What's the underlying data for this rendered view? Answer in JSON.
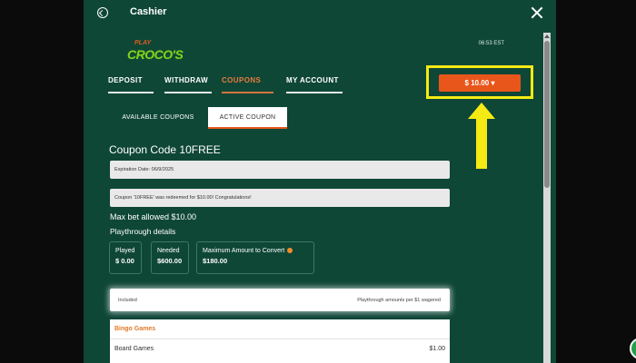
{
  "window": {
    "title": "Cashier",
    "back_icon": "back-icon",
    "close_icon": "close-icon"
  },
  "brand": {
    "logo_top": "PLAY",
    "logo_main": "CROCO'S"
  },
  "time": "06:53 EST",
  "tabs": [
    {
      "label": "DEPOSIT",
      "active": false
    },
    {
      "label": "WITHDRAW",
      "active": false
    },
    {
      "label": "COUPONS",
      "active": true
    },
    {
      "label": "MY ACCOUNT",
      "active": false
    }
  ],
  "balance": {
    "label": "$ 10.00 ▾"
  },
  "subtabs": {
    "available": "AVAILABLE COUPONS",
    "active": "ACTIVE COUPON"
  },
  "coupon": {
    "code_label": "Coupon Code  10FREE",
    "expiration": "Expiration Date: 06/9/2025",
    "message": "Coupon '10FREE' was redeemed for $10.00! Congratulations!",
    "max_bet": "Max bet allowed  $10.00",
    "playthrough_label": "Playthrough details"
  },
  "stats": {
    "played": {
      "label": "Played",
      "value": "$ 0.00"
    },
    "needed": {
      "label": "Needed",
      "value": "$600.00"
    },
    "max_convert": {
      "label": "Maximum Amount to Convert",
      "value": "$180.00"
    }
  },
  "included": {
    "left": "Included",
    "right": "Playthrough amounts per $1 wagered"
  },
  "games": {
    "category": "Bingo Games",
    "rows": [
      {
        "name": "Board Games",
        "amount": "$1.00"
      }
    ]
  },
  "colors": {
    "modal_bg": "#0f4737",
    "accent": "#e8561b",
    "highlight": "#f5ea14",
    "active_tab": "#e87a3c"
  }
}
